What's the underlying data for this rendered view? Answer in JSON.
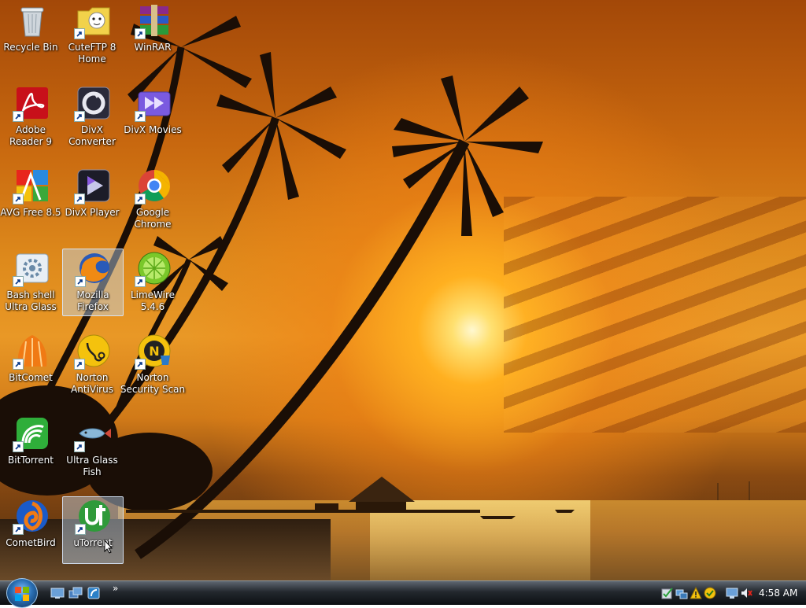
{
  "desktop": {
    "icons": [
      {
        "label": "Recycle Bin",
        "icon": "recycle-bin-icon"
      },
      {
        "label": "CuteFTP 8 Home",
        "icon": "cuteftp-icon"
      },
      {
        "label": "WinRAR",
        "icon": "winrar-icon"
      },
      {
        "label": "Adobe Reader 9",
        "icon": "adobe-reader-icon"
      },
      {
        "label": "DivX Converter",
        "icon": "divx-converter-icon"
      },
      {
        "label": "DivX Movies",
        "icon": "divx-movies-icon"
      },
      {
        "label": "AVG Free 8.5",
        "icon": "avg-icon"
      },
      {
        "label": "DivX Player",
        "icon": "divx-player-icon"
      },
      {
        "label": "Google Chrome",
        "icon": "chrome-icon"
      },
      {
        "label": "Bash shell Ultra Glass",
        "icon": "bash-shell-icon"
      },
      {
        "label": "Mozilla Firefox",
        "icon": "firefox-icon"
      },
      {
        "label": "LimeWire 5.4.6",
        "icon": "limewire-icon"
      },
      {
        "label": "BitComet",
        "icon": "bitcomet-icon"
      },
      {
        "label": "Norton AntiVirus",
        "icon": "norton-antivirus-icon"
      },
      {
        "label": "Norton Security Scan",
        "icon": "norton-security-scan-icon"
      },
      {
        "label": "BitTorrent",
        "icon": "bittorrent-icon"
      },
      {
        "label": "Ultra Glass Fish",
        "icon": "glass-fish-icon"
      },
      {
        "label": "CometBird",
        "icon": "cometbird-icon"
      },
      {
        "label": "uTorrent",
        "icon": "utorrent-icon"
      }
    ]
  },
  "taskbar": {
    "start_icon": "windows-logo-icon",
    "quick_launch": [
      "show-desktop-icon",
      "switch-windows-icon",
      "quick-launch-app-icon"
    ],
    "overflow": "»",
    "tray_icons": [
      "security-check-icon",
      "network-icon",
      "warning-icon",
      "norton-icon",
      "display-icon",
      "volume-muted-icon"
    ],
    "clock": "4:58 AM"
  },
  "colors": {
    "sky": "#de8a1c",
    "sun": "#fff8d0",
    "taskbar": "#23282e",
    "selection": "#bed7f0"
  }
}
